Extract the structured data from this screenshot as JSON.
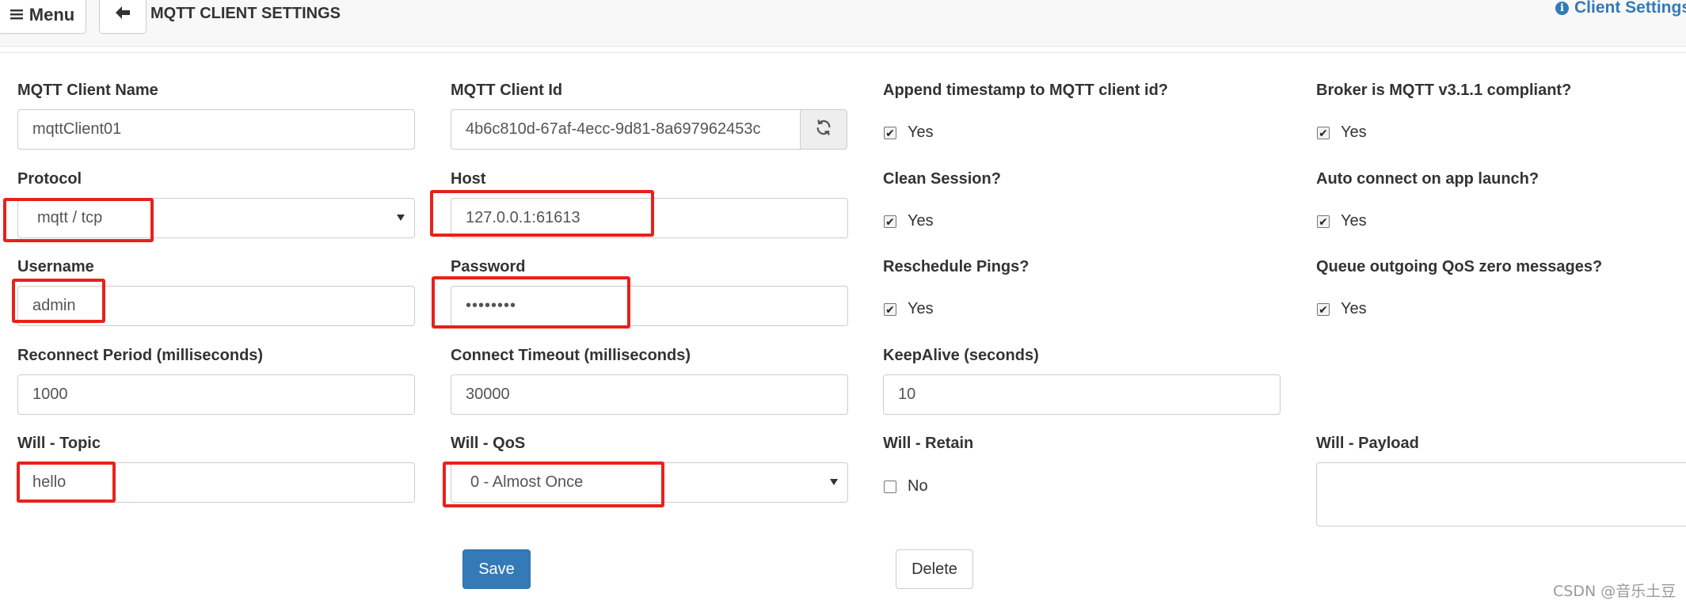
{
  "header": {
    "menu_label": "Menu",
    "title": "MQTT CLIENT SETTINGS",
    "help_label": "Client Settings"
  },
  "form": {
    "client_name": {
      "label": "MQTT Client Name",
      "value": "mqttClient01"
    },
    "client_id": {
      "label": "MQTT Client Id",
      "value": "4b6c810d-67af-4ecc-9d81-8a697962453c"
    },
    "append_timestamp": {
      "label": "Append timestamp to MQTT client id?",
      "option": "Yes",
      "checked": true
    },
    "broker_v311": {
      "label": "Broker is MQTT v3.1.1 compliant?",
      "option": "Yes",
      "checked": true
    },
    "protocol": {
      "label": "Protocol",
      "value": "mqtt / tcp"
    },
    "host": {
      "label": "Host",
      "value": "127.0.0.1:61613"
    },
    "clean_session": {
      "label": "Clean Session?",
      "option": "Yes",
      "checked": true
    },
    "auto_connect": {
      "label": "Auto connect on app launch?",
      "option": "Yes",
      "checked": true
    },
    "username": {
      "label": "Username",
      "value": "admin"
    },
    "password": {
      "label": "Password",
      "value": "••••••••"
    },
    "reschedule_pings": {
      "label": "Reschedule Pings?",
      "option": "Yes",
      "checked": true
    },
    "queue_qos_zero": {
      "label": "Queue outgoing QoS zero messages?",
      "option": "Yes",
      "checked": true
    },
    "reconnect_period": {
      "label": "Reconnect Period (milliseconds)",
      "value": "1000"
    },
    "connect_timeout": {
      "label": "Connect Timeout (milliseconds)",
      "value": "30000"
    },
    "keepalive": {
      "label": "KeepAlive (seconds)",
      "value": "10"
    },
    "will_topic": {
      "label": "Will - Topic",
      "value": "hello"
    },
    "will_qos": {
      "label": "Will - QoS",
      "value": "0 - Almost Once"
    },
    "will_retain": {
      "label": "Will - Retain",
      "option": "No",
      "checked": false
    },
    "will_payload": {
      "label": "Will - Payload",
      "value": ""
    }
  },
  "actions": {
    "save_label": "Save",
    "delete_label": "Delete"
  },
  "watermark": "CSDN @音乐土豆",
  "colors": {
    "primary": "#337ab7",
    "highlight": "#e8211c"
  }
}
